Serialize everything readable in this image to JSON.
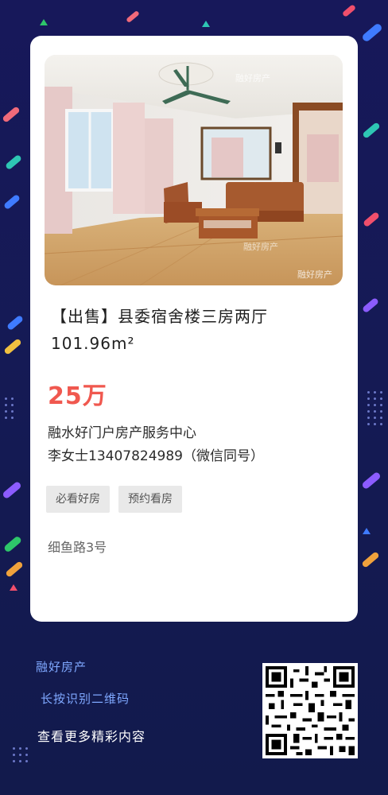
{
  "listing": {
    "title": "【出售】县委宿舍楼三房两厅 101.96m²",
    "price": "25万",
    "agency": "融水好门户房产服务中心",
    "contact": "李女士13407824989（微信同号）",
    "tags": [
      "必看好房",
      "预约看房"
    ],
    "address": "细鱼路3号",
    "photo_watermark": "融好房产"
  },
  "footer": {
    "brand": "融好房产",
    "scan_hint": "长按识别二维码",
    "more": "查看更多精彩内容"
  },
  "colors": {
    "background": "#16185a",
    "price": "#f0584f",
    "footer_text": "#7fa8ff",
    "tag_bg": "#e9e9e9"
  },
  "icons": [
    "qr-code-icon"
  ]
}
